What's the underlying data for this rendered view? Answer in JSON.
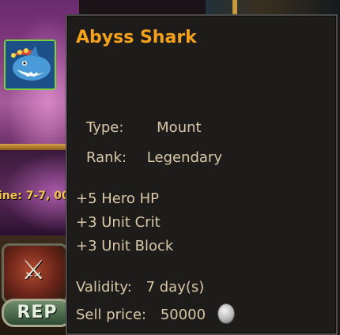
{
  "background": {
    "line_info": "ine: 7-7, 00",
    "rep_button_label": "REP",
    "avatar_icon": "abyss-shark-icon",
    "shield_icon": "crossed-swords-shield-icon"
  },
  "tooltip": {
    "title": "Abyss Shark",
    "type_label": "Type:",
    "type_value": "Mount",
    "rank_label": "Rank:",
    "rank_value": "Legendary",
    "stats": [
      "+5 Hero HP",
      "+3 Unit Crit",
      "+3 Unit Block"
    ],
    "validity_label": "Validity:",
    "validity_value": "7 day(s)",
    "sell_price_label": "Sell price:",
    "sell_price_value": "50000",
    "currency_icon": "silver-coin-icon"
  },
  "colors": {
    "title": "#f4a21c",
    "text": "#d9c8a8",
    "tooltip_bg": "#1e1c1a",
    "tooltip_border": "#4a4a48"
  }
}
